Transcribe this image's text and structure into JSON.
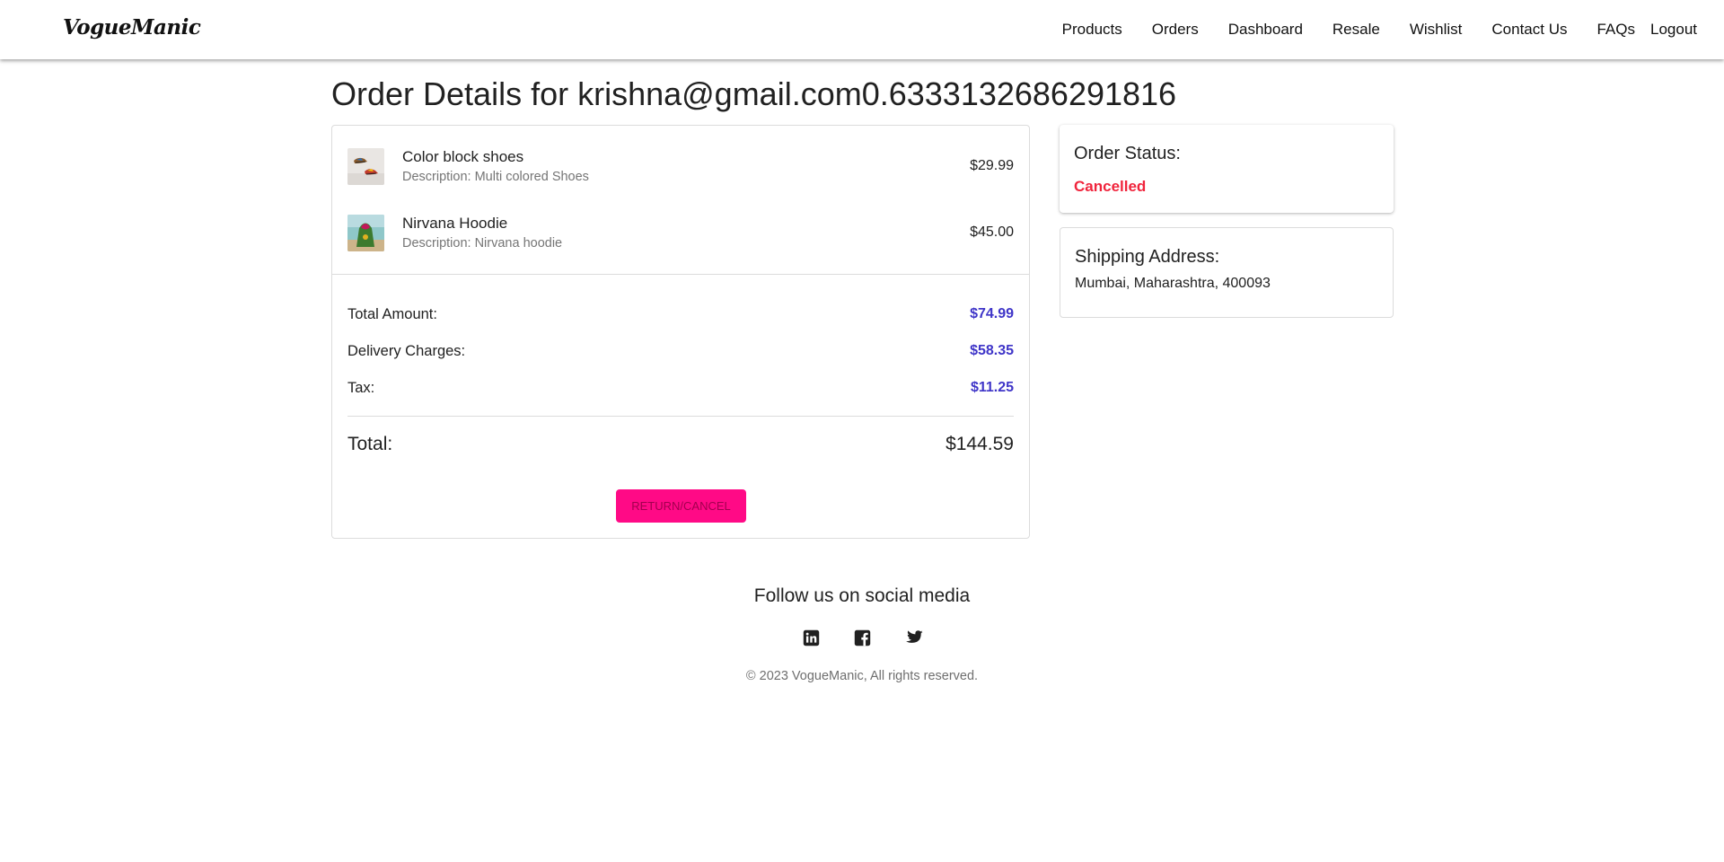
{
  "nav": {
    "brand": "VogueManic",
    "links": [
      "Products",
      "Orders",
      "Dashboard",
      "Resale",
      "Wishlist",
      "Contact Us",
      "FAQs",
      "Logout"
    ]
  },
  "page": {
    "title": "Order Details for krishna@gmail.com0.6333132686291816"
  },
  "order": {
    "items": [
      {
        "name": "Color block shoes",
        "description": "Description: Multi colored Shoes",
        "price": "$29.99",
        "thumb_icon": "shoes-thumbnail"
      },
      {
        "name": "Nirvana Hoodie",
        "description": "Description: Nirvana hoodie",
        "price": "$45.00",
        "thumb_icon": "hoodie-thumbnail"
      }
    ],
    "summary": [
      {
        "label": "Total Amount:",
        "value": "$74.99"
      },
      {
        "label": "Delivery Charges:",
        "value": "$58.35"
      },
      {
        "label": "Tax:",
        "value": "$11.25"
      }
    ],
    "total_label": "Total:",
    "total_value": "$144.59",
    "return_button_label": "RETURN/CANCEL"
  },
  "status": {
    "label": "Order Status:",
    "value": "Cancelled"
  },
  "shipping": {
    "label": "Shipping Address:",
    "address": "Mumbai, Maharashtra, 400093"
  },
  "footer": {
    "title": "Follow us on social media",
    "social_icons": [
      "linkedin-icon",
      "facebook-icon",
      "twitter-icon"
    ],
    "copyright": "© 2023 VogueManic, All rights reserved."
  },
  "colors": {
    "accent_button": "#ff0a86",
    "summary_value": "#3f35c8",
    "status_cancelled": "#f0243c"
  }
}
